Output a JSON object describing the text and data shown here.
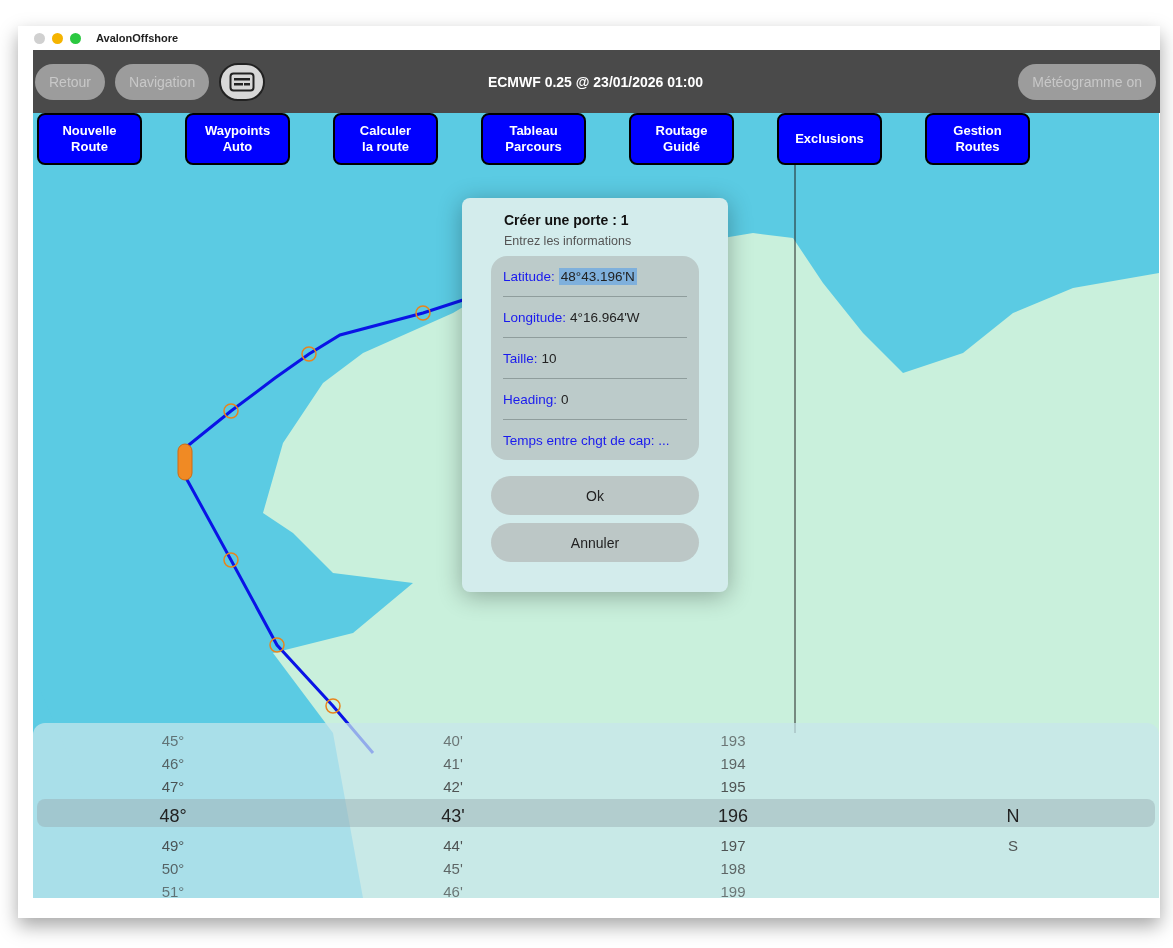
{
  "window": {
    "title": "AvalonOffshore"
  },
  "toolbar": {
    "buttons": [
      {
        "label": "Retour",
        "disabled": true
      },
      {
        "label": "Navigation",
        "disabled": true
      }
    ],
    "forecast": "ECMWF 0.25 @ 23/01/2026 01:00",
    "meteogram_button": {
      "label": "Météogramme on",
      "disabled": true
    }
  },
  "actions": [
    {
      "label": "Nouvelle\nRoute"
    },
    {
      "label": "Waypoints\nAuto"
    },
    {
      "label": "Calculer\nla route"
    },
    {
      "label": "Tableau\nParcours"
    },
    {
      "label": "Routage\nGuidé"
    },
    {
      "label": "Exclusions"
    },
    {
      "label": "Gestion\nRoutes"
    }
  ],
  "dialog": {
    "title": "Créer une porte : 1",
    "subtitle": "Entrez les informations",
    "fields": [
      {
        "label": "Latitude:",
        "value": "48°43.196'N",
        "selected": true
      },
      {
        "label": "Longitude:",
        "value": "4°16.964'W",
        "selected": false
      },
      {
        "label": "Taille:",
        "value": "10",
        "selected": false
      },
      {
        "label": "Heading:",
        "value": "0",
        "selected": false
      },
      {
        "label": "Temps entre chgt de cap: ..."
      }
    ],
    "buttons": [
      "Ok",
      "Annuler"
    ]
  },
  "picker": {
    "columns": [
      {
        "items": [
          {
            "text": "45°",
            "selected": false
          },
          {
            "text": "46°",
            "selected": false
          },
          {
            "text": "47°",
            "selected": false
          },
          {
            "text": "48°",
            "selected": true
          },
          {
            "text": "49°",
            "selected": false
          },
          {
            "text": "50°",
            "selected": false
          },
          {
            "text": "51°",
            "selected": false
          }
        ]
      },
      {
        "items": [
          {
            "text": "40'",
            "selected": false
          },
          {
            "text": "41'",
            "selected": false
          },
          {
            "text": "42'",
            "selected": false
          },
          {
            "text": "43'",
            "selected": true
          },
          {
            "text": "44'",
            "selected": false
          },
          {
            "text": "45'",
            "selected": false
          },
          {
            "text": "46'",
            "selected": false
          }
        ]
      },
      {
        "items": [
          {
            "text": "193",
            "selected": false
          },
          {
            "text": "194",
            "selected": false
          },
          {
            "text": "195",
            "selected": false
          },
          {
            "text": "196",
            "selected": true
          },
          {
            "text": "197",
            "selected": false
          },
          {
            "text": "198",
            "selected": false
          },
          {
            "text": "199",
            "selected": false
          }
        ]
      },
      {
        "items": [
          {
            "text": "N",
            "selected": true
          },
          {
            "text": "S",
            "selected": false
          }
        ]
      }
    ]
  }
}
